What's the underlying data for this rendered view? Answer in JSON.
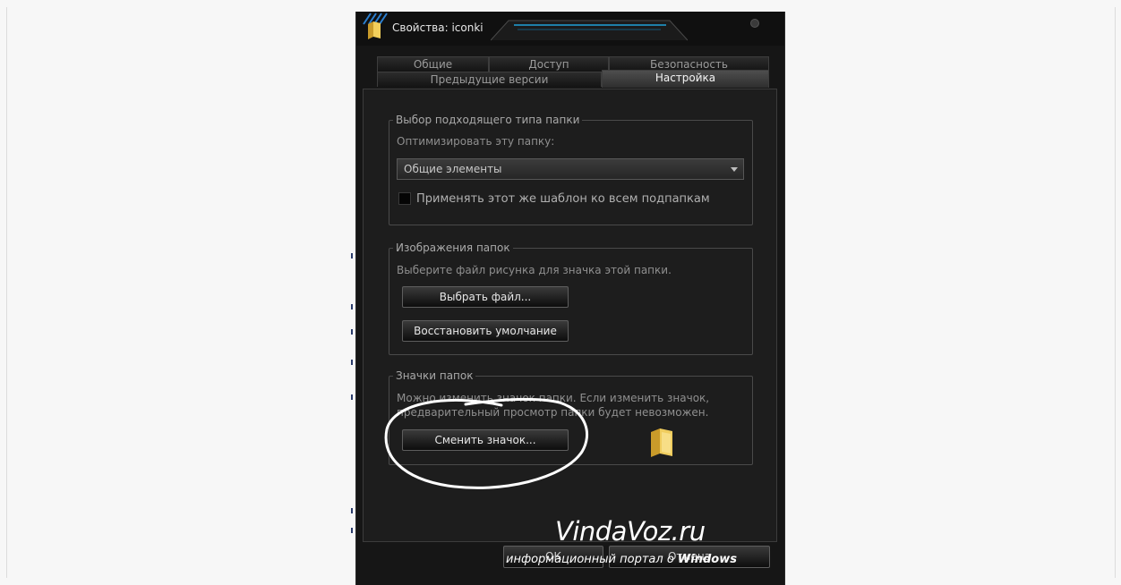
{
  "window": {
    "title": "Свойства: iconki"
  },
  "tabs": {
    "row1": [
      {
        "label": "Общие"
      },
      {
        "label": "Доступ"
      },
      {
        "label": "Безопасность"
      }
    ],
    "row2": [
      {
        "label": "Предыдущие версии"
      },
      {
        "label": "Настройка",
        "active": true
      }
    ]
  },
  "folder_type": {
    "legend": "Выбор подходящего типа папки",
    "optimize_label": "Оптимизировать эту папку:",
    "optimize_value": "Общие элементы",
    "apply_template_label": "Применять этот же шаблон ко всем подпапкам",
    "apply_template_checked": false
  },
  "folder_pictures": {
    "legend": "Изображения папок",
    "description": "Выберите файл рисунка для значка этой папки.",
    "choose_file_button": "Выбрать файл...",
    "restore_default_button": "Восстановить умолчание"
  },
  "folder_icons": {
    "legend": "Значки папок",
    "description_line1": "Можно изменить значок папки. Если изменить значок,",
    "description_line2": "предварительный просмотр папки будет невозможен.",
    "change_icon_button": "Сменить значок..."
  },
  "footer": {
    "ok_button": "ОК",
    "cancel_button": "Отмена"
  },
  "watermark": {
    "title": "VindaVoz.ru",
    "subtitle_prefix": "информационный портал о ",
    "subtitle_bold": "Windows"
  },
  "colors": {
    "dialog_bg": "#161616",
    "panel_bg": "#1d1d1d",
    "accent_title_bar": "#1e7fa8",
    "folder_yellow": "#e8c14a"
  }
}
